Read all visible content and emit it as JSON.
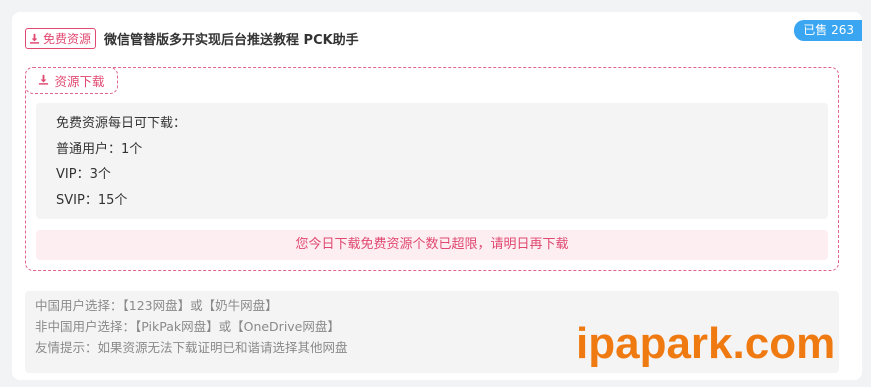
{
  "header": {
    "badge_label": "免费资源",
    "badge_icon": "download-icon",
    "title": "微信管替版多开实现后台推送教程 PCK助手",
    "sold_label": "已售 263"
  },
  "download": {
    "tab_label": "资源下载",
    "tab_icon": "download-icon",
    "info_lines": [
      "免费资源每日可下载：",
      "普通用户：1个",
      "VIP：3个",
      "SVIP：15个"
    ],
    "limit_message": "您今日下载免费资源个数已超限，请明日再下载"
  },
  "notes": [
    "中国用户选择：【123网盘】或【奶牛网盘】",
    "非中国用户选择：【PikPak网盘】或【OneDrive网盘】",
    "友情提示：如果资源无法下载证明已和谐请选择其他网盘"
  ],
  "watermark": "ipapark.com",
  "colors": {
    "accent": "#e04870",
    "sold_badge": "#3aa6f2",
    "watermark": "#f07a12"
  }
}
